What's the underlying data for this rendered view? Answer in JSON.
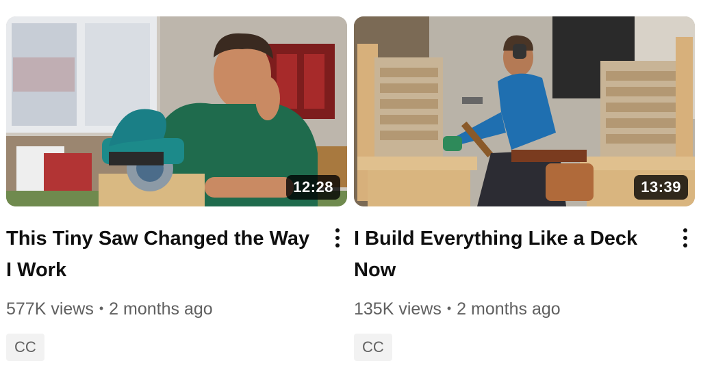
{
  "videos": [
    {
      "title": "This Tiny Saw Changed the Way I Work",
      "duration": "12:28",
      "views": "577K views",
      "separator": "•",
      "age": "2 months ago",
      "badge": "CC"
    },
    {
      "title": "I Build Everything Like a Deck Now",
      "duration": "13:39",
      "views": "135K views",
      "separator": "•",
      "age": "2 months ago",
      "badge": "CC"
    }
  ],
  "icons": {
    "menu": "more-vert-icon"
  },
  "colors": {
    "title": "#0f0f0f",
    "secondary_text": "#606060",
    "badge_bg": "#f2f2f2",
    "duration_bg": "#000000"
  }
}
